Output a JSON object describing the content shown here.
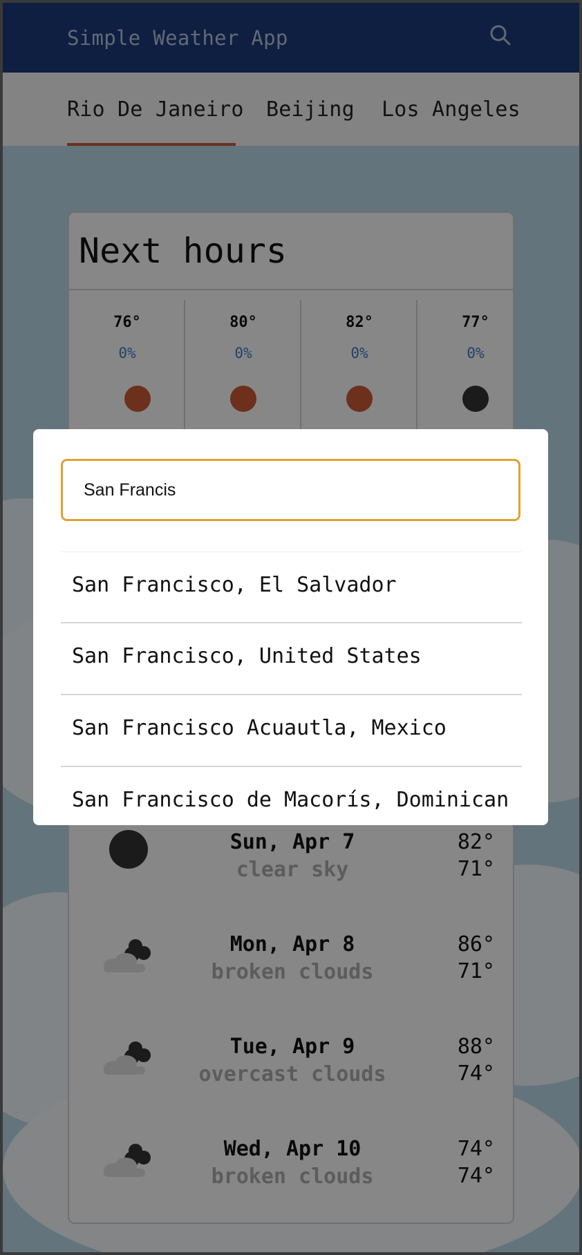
{
  "app": {
    "title": "Simple Weather App",
    "icon_search": "search-icon"
  },
  "tabs": [
    {
      "label": "Rio De Janeiro",
      "selected": true
    },
    {
      "label": "Beijing",
      "selected": false
    },
    {
      "label": "Los Angeles",
      "selected": false
    }
  ],
  "next_hours": {
    "title": "Next hours",
    "items": [
      {
        "temp": "76°",
        "pop": "0%",
        "icon": "sun-icon",
        "color": "#c75a37"
      },
      {
        "temp": "80°",
        "pop": "0%",
        "icon": "sun-icon",
        "color": "#c75a37"
      },
      {
        "temp": "82°",
        "pop": "0%",
        "icon": "sun-icon",
        "color": "#c75a37"
      },
      {
        "temp": "77°",
        "pop": "0%",
        "icon": "moon-icon",
        "color": "#333333"
      }
    ]
  },
  "daily": [
    {
      "day": "Sun, Apr 7",
      "desc": "clear sky",
      "hi": "82°",
      "lo": "71°",
      "icon": "moon-icon"
    },
    {
      "day": "Mon, Apr 8",
      "desc": "broken clouds",
      "hi": "86°",
      "lo": "71°",
      "icon": "broken-clouds-icon"
    },
    {
      "day": "Tue, Apr 9",
      "desc": "overcast clouds",
      "hi": "88°",
      "lo": "74°",
      "icon": "overcast-clouds-icon"
    },
    {
      "day": "Wed, Apr 10",
      "desc": "broken clouds",
      "hi": "74°",
      "lo": "74°",
      "icon": "broken-clouds-icon"
    }
  ],
  "search_dialog": {
    "input_value": "San Francis",
    "results": [
      "San Francisco, El Salvador",
      "San Francisco, United States",
      "San Francisco Acuautla, Mexico",
      "San Francisco de Macorís, Dominican"
    ]
  },
  "colors": {
    "appbar": "#1c3a7a",
    "accent": "#c75a37",
    "input_border": "#e0a132",
    "precip": "#3c78c8"
  }
}
